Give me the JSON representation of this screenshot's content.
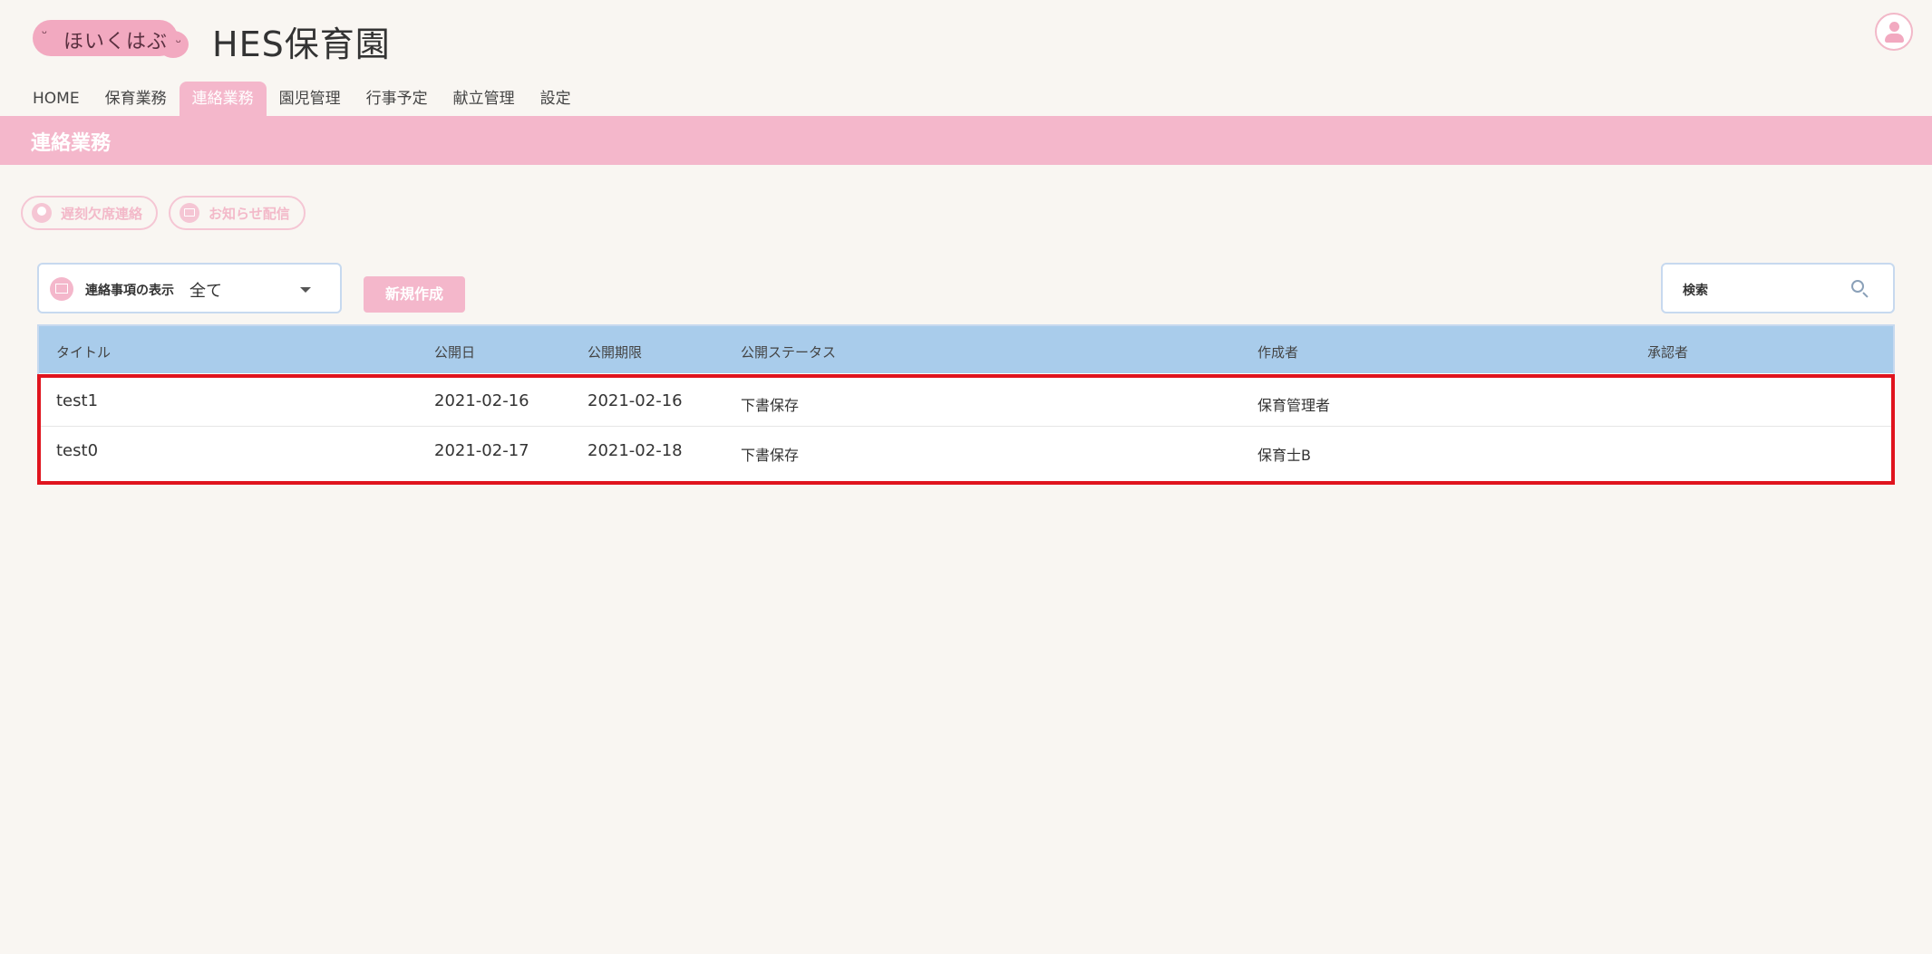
{
  "header": {
    "logo_text": "ほいくはぶ",
    "app_title": "HES保育園"
  },
  "nav": {
    "tabs": [
      {
        "label": "HOME"
      },
      {
        "label": "保育業務"
      },
      {
        "label": "連絡業務",
        "active": true
      },
      {
        "label": "園児管理"
      },
      {
        "label": "行事予定"
      },
      {
        "label": "献立管理"
      },
      {
        "label": "設定"
      }
    ]
  },
  "page": {
    "title": "連絡業務"
  },
  "actions": {
    "attendance_label": "遅刻欠席連絡",
    "notice_label": "お知らせ配信"
  },
  "filter": {
    "label": "連絡事項の表示",
    "value": "全て"
  },
  "new_button": "新規作成",
  "search": {
    "placeholder": "検索"
  },
  "table": {
    "headers": {
      "title": "タイトル",
      "publish_date": "公開日",
      "publish_end": "公開期限",
      "status": "公開ステータス",
      "author": "作成者",
      "approver": "承認者"
    },
    "rows": [
      {
        "title": "test1",
        "publish_date": "2021-02-16",
        "publish_end": "2021-02-16",
        "status": "下書保存",
        "author": "保育管理者",
        "approver": ""
      },
      {
        "title": "test0",
        "publish_date": "2021-02-17",
        "publish_end": "2021-02-18",
        "status": "下書保存",
        "author": "保育士B",
        "approver": ""
      }
    ]
  },
  "colors": {
    "accent_pink": "#f4b7cb",
    "table_header": "#a9cceb",
    "highlight": "#e0141e",
    "background": "#f9f6f2"
  }
}
